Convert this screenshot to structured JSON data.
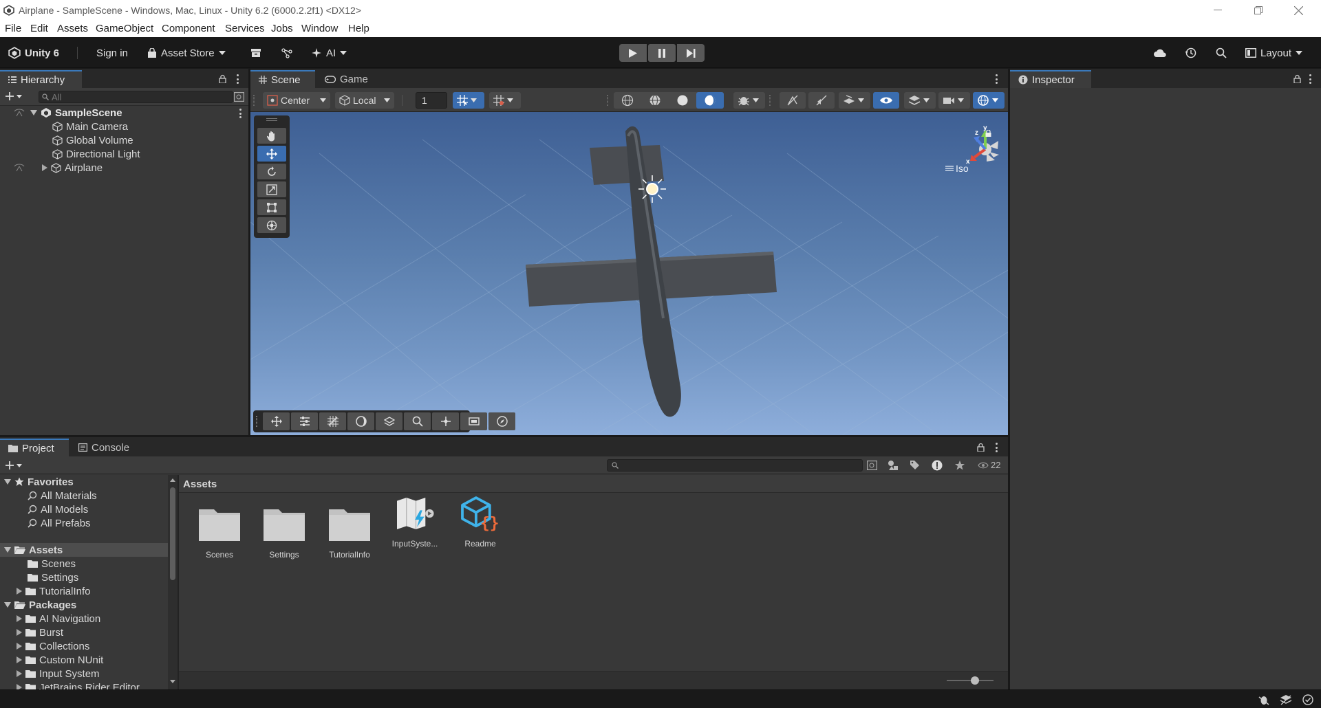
{
  "window": {
    "title": "Airplane - SampleScene - Windows, Mac, Linux - Unity 6.2 (6000.2.2f1) <DX12>"
  },
  "menu": [
    "File",
    "Edit",
    "Assets",
    "GameObject",
    "Component",
    "Services",
    "Jobs",
    "Window",
    "Help"
  ],
  "toolbar": {
    "unity_label": "Unity 6",
    "sign_in": "Sign in",
    "asset_store": "Asset Store",
    "ai": "AI",
    "layout": "Layout"
  },
  "hierarchy": {
    "tab": "Hierarchy",
    "search_placeholder": "All",
    "scene": "SampleScene",
    "items": [
      "Main Camera",
      "Global Volume",
      "Directional Light",
      "Airplane"
    ]
  },
  "scene": {
    "tabs": [
      "Scene",
      "Game"
    ],
    "pivot": "Center",
    "space": "Local",
    "snap_value": "1",
    "gizmo_projection": "Iso",
    "gizmo_axes": [
      "y",
      "z",
      "x"
    ]
  },
  "inspector": {
    "tab": "Inspector"
  },
  "project": {
    "tabs": [
      "Project",
      "Console"
    ],
    "badge_count": "22",
    "favorites": {
      "label": "Favorites",
      "items": [
        "All Materials",
        "All Models",
        "All Prefabs"
      ]
    },
    "assets": {
      "label": "Assets",
      "items": [
        "Scenes",
        "Settings",
        "TutorialInfo"
      ]
    },
    "packages": {
      "label": "Packages",
      "items": [
        "AI Navigation",
        "Burst",
        "Collections",
        "Custom NUnit",
        "Input System",
        "JetBrains Rider Editor"
      ]
    },
    "breadcrumb": "Assets",
    "grid_items": [
      "Scenes",
      "Settings",
      "TutorialInfo",
      "InputSyste...",
      "Readme"
    ]
  },
  "colors": {
    "accent": "#3a79bb",
    "panel": "#383838",
    "toolbar": "#191919",
    "sky_top": "#3e5f94",
    "sky_bottom": "#8eaedb"
  }
}
